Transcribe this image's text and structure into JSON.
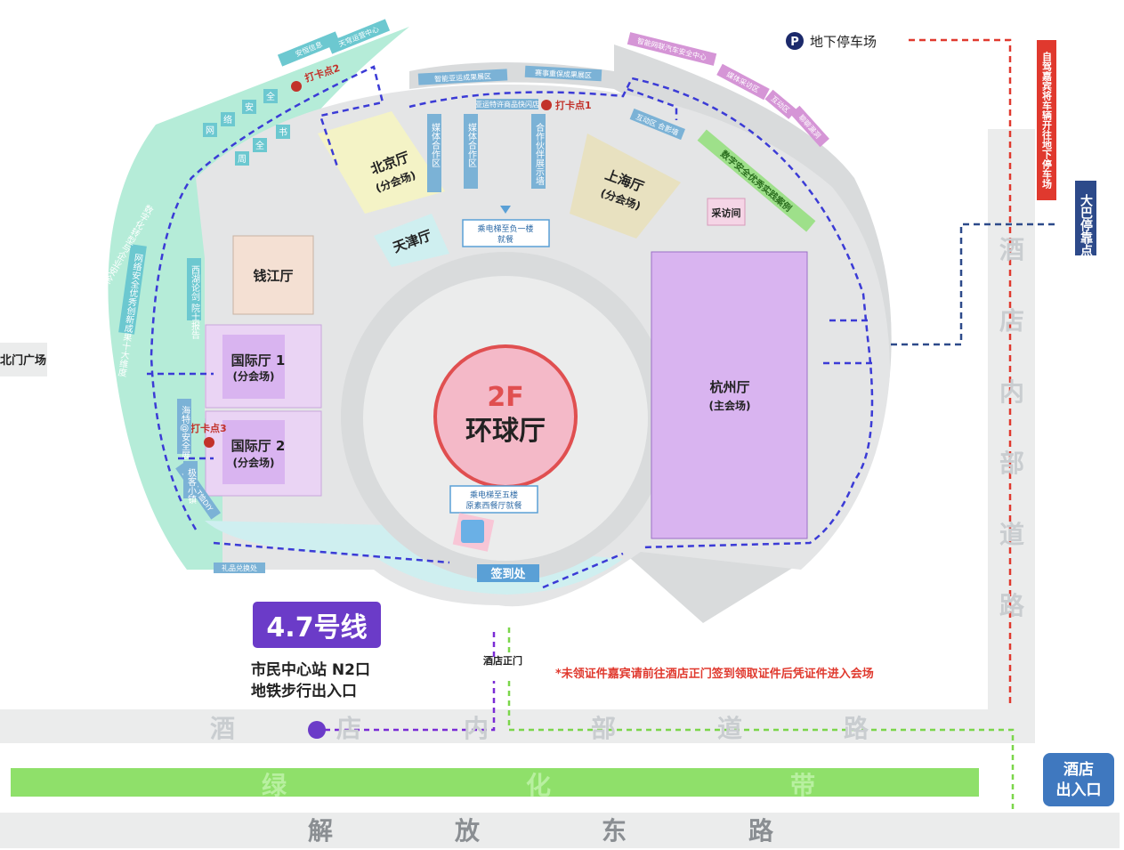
{
  "center": {
    "floor": "2F",
    "name": "环球厅"
  },
  "halls": {
    "hangzhou": {
      "name": "杭州厅",
      "sub": "(主会场)"
    },
    "beijing": {
      "name": "北京厅",
      "sub": "(分会场)"
    },
    "shanghai": {
      "name": "上海厅",
      "sub": "(分会场)"
    },
    "tianjin": {
      "name": "天津厅"
    },
    "qianjiang": {
      "name": "钱江厅"
    },
    "guoji1": {
      "name": "国际厅 1",
      "sub": "(分会场)"
    },
    "guoji2": {
      "name": "国际厅 2",
      "sub": "(分会场)"
    },
    "caifang": {
      "name": "采访间"
    }
  },
  "elevators": {
    "to_b1": {
      "line1": "乘电梯至负一楼",
      "line2": "就餐"
    },
    "to_5f": {
      "line1": "乘电梯至五楼",
      "line2": "原素西餐厅就餐"
    }
  },
  "checkin": "签到处",
  "checkpoints": {
    "p1": "打卡点1",
    "p2": "打卡点2",
    "p3": "打卡点3"
  },
  "zones": {
    "top_left_1": "安恒信息",
    "top_left_2": "天穹运营中心",
    "top_mid_1": "智能亚运成果展区",
    "top_mid_2": "赛事重保成果展区",
    "top_right_1": "智能网联汽车安全中心",
    "top_right_2": "媒体采访区",
    "top_right_3": "互动区",
    "top_right_4": "聊聊漏洞",
    "interactive": "互动区 合影墙",
    "digital": "数字安全优秀实践案例",
    "goods": "亚运特许商品快闪店",
    "media_v": "媒体合作区",
    "media_v2": "媒体合作区",
    "partner": "合作伙伴展示墙",
    "left_v1": "网",
    "left_v2": "络",
    "left_v3": "安",
    "left_v4": "全",
    "left_v5": "周",
    "left_v6": "全",
    "left_v7": "书",
    "left_arc": "数字化转型与企业安全",
    "left_arc2": "网络安全优秀创新成果十大维度",
    "left_inner": "西湖论剑 院士报告",
    "hai_v": "海特@安全展",
    "jike": "极客小镇",
    "huodong": "互动区 T恤DIY",
    "gift": "礼品兑换处"
  },
  "labels": {
    "north_plaza": "北门广场",
    "parking": "地下停车场",
    "self_drive": "自驾嘉宾将车辆开往地下停车场",
    "bus": "大巴停靠点",
    "hotel_gate": "酒店正门",
    "metro_line": "4.7号线",
    "metro_station": "市民中心站 N2口",
    "metro_exit": "地铁步行出入口",
    "notice": "*未领证件嘉宾请前往酒店正门签到领取证件后凭证件进入会场",
    "hotel_exit_1": "酒店",
    "hotel_exit_2": "出入口"
  },
  "roads": {
    "inner_h": [
      "酒",
      "店",
      "内",
      "部",
      "道",
      "路"
    ],
    "inner_v": [
      "酒",
      "店",
      "内",
      "部",
      "道",
      "路"
    ],
    "green": [
      "绿",
      "化",
      "带"
    ],
    "jiefang": [
      "解",
      "放",
      "东",
      "路"
    ]
  },
  "colors": {
    "outer_green": "#b5ecd8",
    "gray": "#d9dbdc",
    "light_gray": "#ebecec",
    "purple": "#d9b4f0",
    "pink_center": "#f4b9c8",
    "center_border": "#e04f50",
    "yellow": "#f4f3c6",
    "olive": "#e8e1c0",
    "teal": "#cfeff0",
    "green_band": "#8fe06a",
    "metro": "#6b3bc8"
  }
}
